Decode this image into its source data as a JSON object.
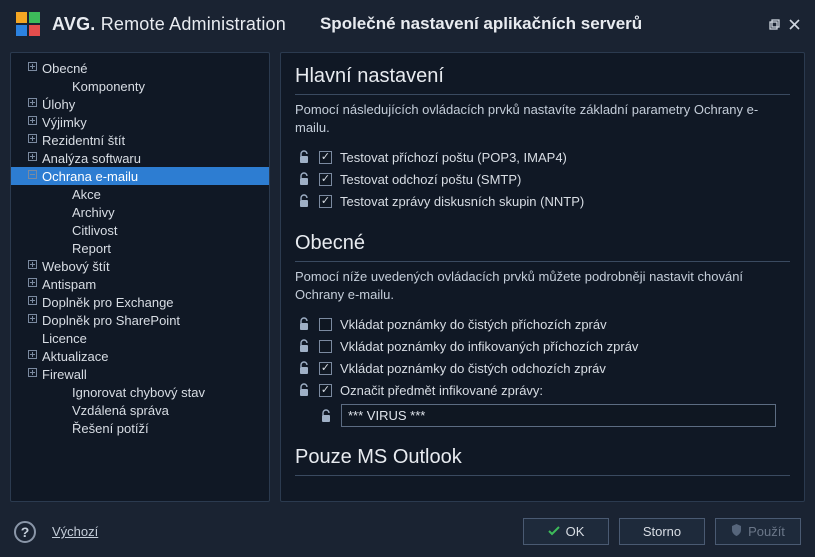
{
  "brand": {
    "strong": "AVG",
    "light": "Remote Administration"
  },
  "page_title": "Společné nastavení aplikačních serverů",
  "sidebar": {
    "items": [
      {
        "label": "Obecné",
        "expandable": true
      },
      {
        "label": "Komponenty",
        "expandable": false,
        "child": true
      },
      {
        "label": "Úlohy",
        "expandable": true
      },
      {
        "label": "Výjimky",
        "expandable": true
      },
      {
        "label": "Rezidentní štít",
        "expandable": true
      },
      {
        "label": "Analýza softwaru",
        "expandable": true
      },
      {
        "label": "Ochrana e-mailu",
        "expandable": true,
        "expanded": true,
        "selected": true
      },
      {
        "label": "Akce",
        "expandable": false,
        "child": true
      },
      {
        "label": "Archivy",
        "expandable": false,
        "child": true
      },
      {
        "label": "Citlivost",
        "expandable": false,
        "child": true
      },
      {
        "label": "Report",
        "expandable": false,
        "child": true
      },
      {
        "label": "Webový štít",
        "expandable": true
      },
      {
        "label": "Antispam",
        "expandable": true
      },
      {
        "label": "Doplněk pro Exchange",
        "expandable": true
      },
      {
        "label": "Doplněk pro SharePoint",
        "expandable": true
      },
      {
        "label": "Licence",
        "expandable": false
      },
      {
        "label": "Aktualizace",
        "expandable": true
      },
      {
        "label": "Firewall",
        "expandable": true
      },
      {
        "label": "Ignorovat chybový stav",
        "expandable": false,
        "child": true
      },
      {
        "label": "Vzdálená správa",
        "expandable": false,
        "child": true
      },
      {
        "label": "Řešení potíží",
        "expandable": false,
        "child": true
      }
    ]
  },
  "sections": {
    "main": {
      "title": "Hlavní nastavení",
      "desc": "Pomocí následujících ovládacích prvků nastavíte základní parametry Ochrany e-mailu.",
      "opts": [
        {
          "label": "Testovat příchozí poštu (POP3, IMAP4)",
          "checked": true
        },
        {
          "label": "Testovat odchozí poštu (SMTP)",
          "checked": true
        },
        {
          "label": "Testovat zprávy diskusních skupin (NNTP)",
          "checked": true
        }
      ]
    },
    "general": {
      "title": "Obecné",
      "desc": "Pomocí níže uvedených ovládacích prvků můžete podrobněji nastavit chování Ochrany e-mailu.",
      "opts": [
        {
          "label": "Vkládat poznámky do čistých příchozích zpráv",
          "checked": false
        },
        {
          "label": "Vkládat poznámky do infikovaných příchozích zpráv",
          "checked": false
        },
        {
          "label": "Vkládat poznámky do čistých odchozích zpráv",
          "checked": true
        },
        {
          "label": "Označit předmět infikované zprávy:",
          "checked": true
        }
      ],
      "virus_text": "*** VIRUS ***"
    },
    "outlook": {
      "title": "Pouze MS Outlook"
    }
  },
  "footer": {
    "default": "Výchozí",
    "ok": "OK",
    "cancel": "Storno",
    "apply": "Použít"
  }
}
